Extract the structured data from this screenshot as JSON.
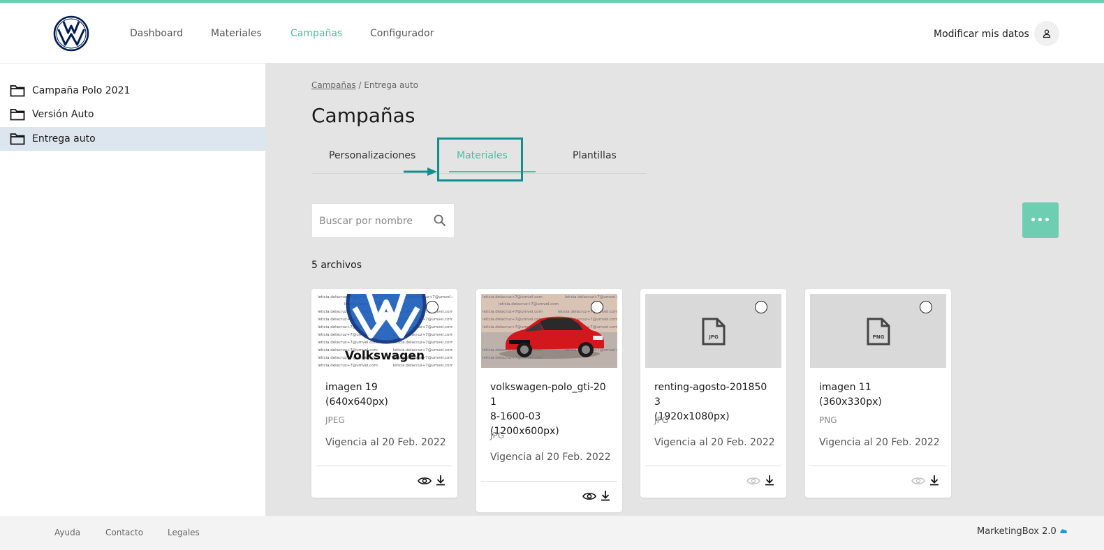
{
  "header": {
    "nav": [
      "Dashboard",
      "Materiales",
      "Campañas",
      "Configurador"
    ],
    "active_nav": "Campañas",
    "modify_label": "Modificar mis datos"
  },
  "sidebar": {
    "items": [
      {
        "label": "Campaña Polo 2021"
      },
      {
        "label": "Versión Auto"
      },
      {
        "label": "Entrega auto",
        "selected": true
      }
    ]
  },
  "main": {
    "breadcrumb": {
      "link": "Campañas",
      "separator": " / ",
      "current": "Entrega auto"
    },
    "title": "Campañas",
    "tabs": [
      {
        "label": "Personalizaciones"
      },
      {
        "label": "Materiales",
        "active": true
      },
      {
        "label": "Plantillas"
      }
    ],
    "search_placeholder": "Buscar por nombre",
    "more_label": "•••",
    "count": "5 archivos",
    "cards": [
      {
        "name_lines": [
          "imagen 19",
          "(640x640px)"
        ],
        "type": "JPEG",
        "date": "Vigencia al 20 Feb. 2022",
        "thumb": "vw-watermark",
        "preview_enabled": true
      },
      {
        "name_lines": [
          "volkswagen-polo_gti-201",
          "8-1600-03",
          "(1200x600px)"
        ],
        "type": "JPG",
        "date": "Vigencia al 20 Feb. 2022",
        "thumb": "car-photo",
        "preview_enabled": true
      },
      {
        "name_lines": [
          "renting-agosto-2018503",
          "(1920x1080px)"
        ],
        "type": "JPG",
        "date": "Vigencia al 20 Feb. 2022",
        "thumb": "file-icon-jpg",
        "thumb_label": "JPG",
        "preview_enabled": false
      },
      {
        "name_lines": [
          "imagen 11",
          "(360x330px)"
        ],
        "type": "PNG",
        "date": "Vigencia al 20 Feb. 2022",
        "thumb": "file-icon-png",
        "thumb_label": "PNG",
        "preview_enabled": false
      }
    ],
    "watermark_text": "leticia.delacruz+7@umvel.com",
    "brand_text": "Volkswagen"
  },
  "footer": {
    "links": [
      "Ayuda",
      "Contacto",
      "Legales"
    ],
    "brand": "MarketingBox 2.0"
  },
  "colors": {
    "accent": "#6fcdb1",
    "active_text": "#4cbf9c",
    "highlight": "#138d8d",
    "vw_blue": "#001e50",
    "selected_bg": "#dde6ee"
  }
}
